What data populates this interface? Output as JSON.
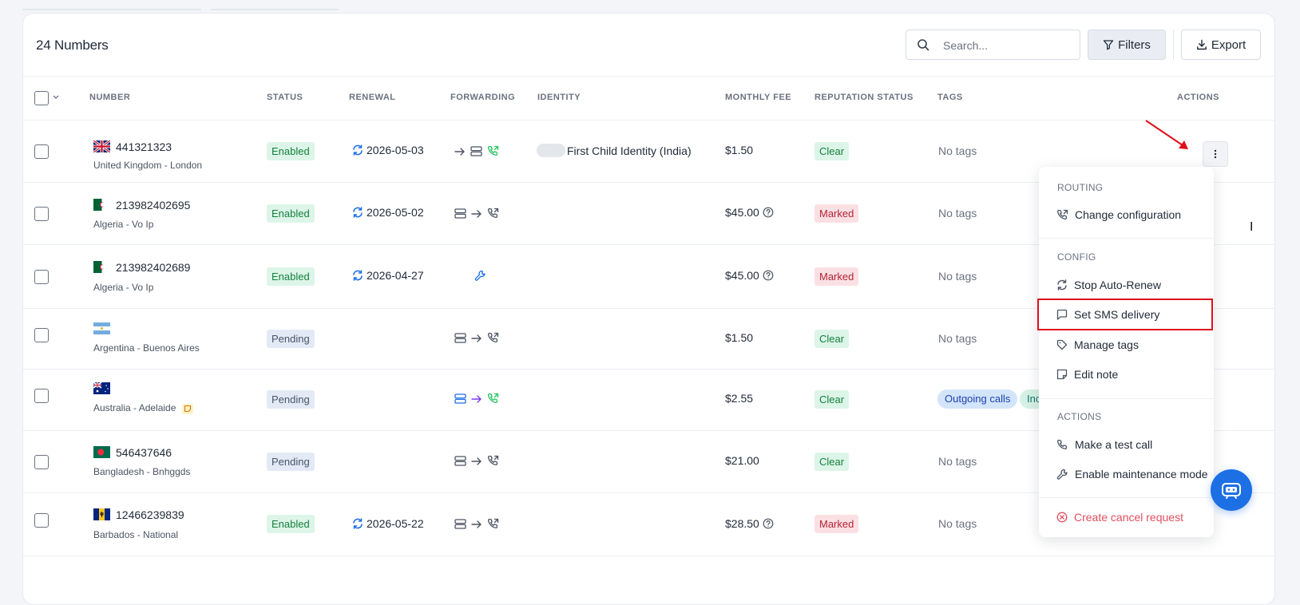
{
  "header": {
    "count_title": "24 Numbers",
    "search_placeholder": "Search...",
    "filters_label": "Filters",
    "export_label": "Export"
  },
  "columns": [
    "NUMBER",
    "STATUS",
    "RENEWAL",
    "FORWARDING",
    "IDENTITY",
    "MONTHLY FEE",
    "REPUTATION STATUS",
    "TAGS",
    "ACTIONS"
  ],
  "rows": [
    {
      "number": "441321323",
      "location": "United Kingdom - London",
      "status": "Enabled",
      "renewal": "2026-05-03",
      "identity": "First Child Identity (India)",
      "fee": "$1.50",
      "reputation": "Clear",
      "tags": "No tags"
    },
    {
      "number": "213982402695",
      "location": "Algeria - Vo Ip",
      "status": "Enabled",
      "renewal": "2026-05-02",
      "identity": "",
      "fee": "$45.00",
      "reputation": "Marked",
      "tags": "No tags"
    },
    {
      "number": "213982402689",
      "location": "Algeria - Vo Ip",
      "status": "Enabled",
      "renewal": "2026-04-27",
      "identity": "",
      "fee": "$45.00",
      "reputation": "Marked",
      "tags": "No tags"
    },
    {
      "number": "",
      "location": "Argentina - Buenos Aires",
      "status": "Pending",
      "renewal": "",
      "identity": "",
      "fee": "$1.50",
      "reputation": "Clear",
      "tags": "No tags"
    },
    {
      "number": "",
      "location": "Australia - Adelaide",
      "status": "Pending",
      "renewal": "",
      "identity": "",
      "fee": "$2.55",
      "reputation": "Clear",
      "tags": "",
      "tag_list": [
        "Outgoing calls",
        "Inc"
      ]
    },
    {
      "number": "546437646",
      "location": "Bangladesh - Bnhggds",
      "status": "Pending",
      "renewal": "",
      "identity": "",
      "fee": "$21.00",
      "reputation": "Clear",
      "tags": "No tags"
    },
    {
      "number": "12466239839",
      "location": "Barbados - National",
      "status": "Enabled",
      "renewal": "2026-05-22",
      "identity": "",
      "fee": "$28.50",
      "reputation": "Marked",
      "tags": "No tags"
    }
  ],
  "menu": {
    "routing_header": "ROUTING",
    "change_configuration": "Change configuration",
    "config_header": "CONFIG",
    "stop_auto_renew": "Stop Auto-Renew",
    "set_sms_delivery": "Set SMS delivery",
    "manage_tags": "Manage tags",
    "edit_note": "Edit note",
    "actions_header": "ACTIONS",
    "make_test_call": "Make a test call",
    "enable_maintenance": "Enable maintenance mode",
    "create_cancel": "Create cancel request"
  },
  "colors": {
    "accent": "#1d6fe4",
    "enabled_bg": "#dcf5e8",
    "marked_bg": "#fbe0e3",
    "pending_bg": "#e3eaf6",
    "danger": "#e04f5f",
    "highlight": "#e0101a"
  }
}
